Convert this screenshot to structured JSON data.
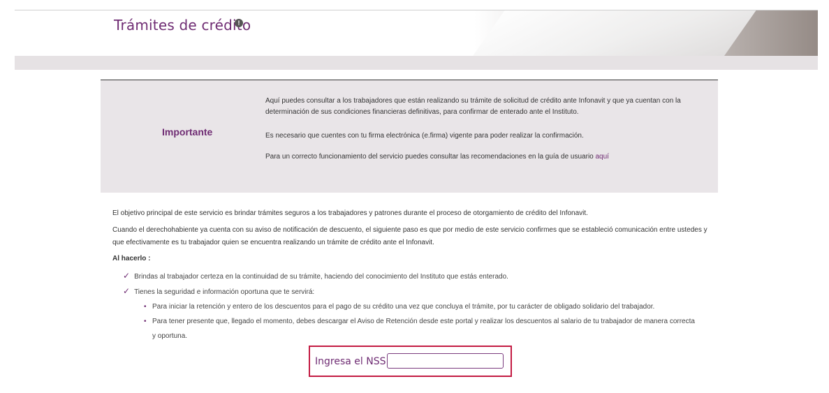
{
  "header": {
    "title": "Trámites de crédito",
    "info_icon_glyph": "!"
  },
  "notice": {
    "label": "Importante",
    "paragraph1": "Aquí puedes consultar a los trabajadores que están realizando su trámite de solicitud de crédito ante Infonavit y que ya cuentan con la determinación de sus condiciones financieras definitivas, para confirmar de enterado ante el Instituto.",
    "paragraph2": "Es necesario que cuentes con tu firma electrónica (e.firma) vigente para poder realizar la confirmación.",
    "paragraph3_prefix": "Para un correcto funcionamiento del servicio puedes consultar las recomendaciones en la guía de usuario ",
    "link_text": "aquí"
  },
  "main": {
    "objective": "El objetivo principal de este servicio es brindar trámites seguros a los trabajadores y patrones durante el proceso de otorgamiento de crédito del Infonavit.",
    "description": "Cuando el derechohabiente ya cuenta con su aviso de notificación de descuento, el siguiente paso es que por medio de este servicio confirmes que se estableció comunicación entre ustedes y que efectivamente es tu trabajador quien se encuentra realizando un trámite de crédito ante el Infonavit.",
    "al_hacerlo": "Al hacerlo :",
    "check_items": [
      "Brindas al trabajador certeza en la continuidad de su trámite, haciendo del conocimiento del Instituto que estás enterado.",
      "Tienes la seguridad e información oportuna que te servirá:"
    ],
    "bullet_items": [
      "Para iniciar la retención y entero de los descuentos para el pago de su crédito una vez que concluya el trámite, por tu carácter de obligado solidario del trabajador.",
      "Para tener presente que, llegado el momento, debes descargar el Aviso de Retención desde este portal y realizar los descuentos al salario de tu trabajador de manera correcta y oportuna."
    ],
    "check_glyph": "✓",
    "bullet_glyph": "•"
  },
  "nss": {
    "label": "Ingresa el NSS",
    "value": ""
  },
  "colors": {
    "brand_purple": "#6f2c73",
    "highlight_red": "#c31b42",
    "notice_bg": "#e9e5e8"
  }
}
